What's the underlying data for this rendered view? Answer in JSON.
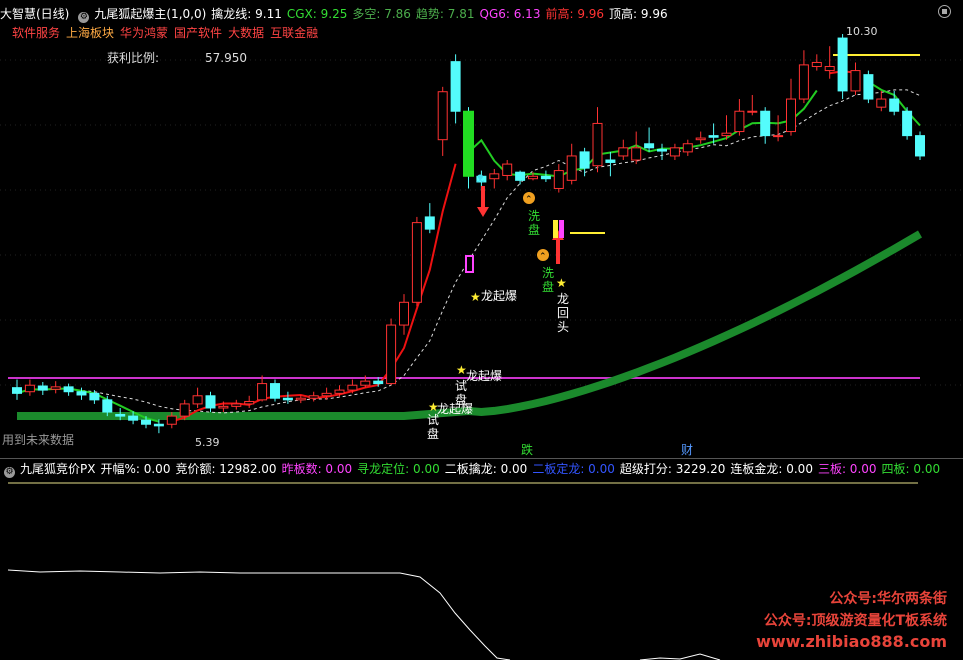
{
  "header": {
    "app_title": "大智慧(日线)",
    "indicator_name": "九尾狐起爆主(1,0,0)",
    "values": [
      {
        "label": "擒龙线: 9.11",
        "color": "#ffffff"
      },
      {
        "label": "CGX: 9.25",
        "color": "#33dd33"
      },
      {
        "label": "多空: 7.86",
        "color": "#4cae4c"
      },
      {
        "label": "趋势: 7.81",
        "color": "#4cae4c"
      },
      {
        "label": "QG6: 6.13",
        "color": "#ff44ff"
      },
      {
        "label": "前高: 9.96",
        "color": "#ff3333"
      },
      {
        "label": "顶高: 9.96",
        "color": "#ffffff"
      }
    ]
  },
  "sectors": [
    {
      "label": "软件服务",
      "color": "#ff4444"
    },
    {
      "label": "上海板块",
      "color": "#ffaa44"
    },
    {
      "label": "华为鸿蒙",
      "color": "#ff4444"
    },
    {
      "label": "国产软件",
      "color": "#ff4444"
    },
    {
      "label": "大数据",
      "color": "#ff4444"
    },
    {
      "label": "互联金融",
      "color": "#ff4444"
    }
  ],
  "main": {
    "profit_label": "获利比例:",
    "profit_value": "57.950",
    "future_data_note": "用到未来数据",
    "high_label": "10.30",
    "low_label": "5.39",
    "signals": {
      "longqibao": "龙起爆",
      "shipan": [
        "试",
        "盘"
      ],
      "xipan": [
        "洗",
        "盘"
      ],
      "longhuitou": [
        "龙",
        "回",
        "头"
      ],
      "die": "跌",
      "cai": "财"
    },
    "colors": {
      "up": "#ff3232",
      "down": "#54fcfc",
      "ma_red": "#ee1111",
      "ma_green": "#22cc22",
      "thick_green": "#1b8a2c",
      "purple": "#cc33cc",
      "yellow": "#ffee33"
    },
    "candles": [
      {
        "o": 5.95,
        "c": 5.88,
        "h": 6.05,
        "l": 5.8
      },
      {
        "o": 5.9,
        "c": 5.98,
        "h": 6.05,
        "l": 5.85
      },
      {
        "o": 5.97,
        "c": 5.92,
        "h": 6.02,
        "l": 5.86
      },
      {
        "o": 5.93,
        "c": 5.96,
        "h": 6.03,
        "l": 5.88
      },
      {
        "o": 5.96,
        "c": 5.9,
        "h": 6.0,
        "l": 5.85
      },
      {
        "o": 5.9,
        "c": 5.86,
        "h": 5.95,
        "l": 5.8
      },
      {
        "o": 5.88,
        "c": 5.8,
        "h": 5.92,
        "l": 5.75
      },
      {
        "o": 5.8,
        "c": 5.65,
        "h": 5.85,
        "l": 5.6
      },
      {
        "o": 5.62,
        "c": 5.6,
        "h": 5.7,
        "l": 5.55
      },
      {
        "o": 5.6,
        "c": 5.55,
        "h": 5.66,
        "l": 5.5
      },
      {
        "o": 5.55,
        "c": 5.5,
        "h": 5.6,
        "l": 5.45
      },
      {
        "o": 5.5,
        "c": 5.48,
        "h": 5.56,
        "l": 5.39
      },
      {
        "o": 5.5,
        "c": 5.6,
        "h": 5.65,
        "l": 5.45
      },
      {
        "o": 5.6,
        "c": 5.75,
        "h": 5.8,
        "l": 5.55
      },
      {
        "o": 5.75,
        "c": 5.85,
        "h": 5.95,
        "l": 5.7
      },
      {
        "o": 5.85,
        "c": 5.7,
        "h": 5.9,
        "l": 5.65
      },
      {
        "o": 5.7,
        "c": 5.72,
        "h": 5.78,
        "l": 5.65
      },
      {
        "o": 5.72,
        "c": 5.75,
        "h": 5.8,
        "l": 5.68
      },
      {
        "o": 5.75,
        "c": 5.78,
        "h": 5.85,
        "l": 5.7
      },
      {
        "o": 5.8,
        "c": 6.0,
        "h": 6.1,
        "l": 5.78
      },
      {
        "o": 6.0,
        "c": 5.82,
        "h": 6.05,
        "l": 5.78
      },
      {
        "o": 5.82,
        "c": 5.8,
        "h": 5.9,
        "l": 5.75
      },
      {
        "o": 5.8,
        "c": 5.82,
        "h": 5.86,
        "l": 5.76
      },
      {
        "o": 5.82,
        "c": 5.85,
        "h": 5.9,
        "l": 5.78
      },
      {
        "o": 5.85,
        "c": 5.88,
        "h": 5.95,
        "l": 5.8
      },
      {
        "o": 5.88,
        "c": 5.92,
        "h": 5.98,
        "l": 5.84
      },
      {
        "o": 5.92,
        "c": 5.98,
        "h": 6.05,
        "l": 5.88
      },
      {
        "o": 5.98,
        "c": 6.03,
        "h": 6.1,
        "l": 5.95
      },
      {
        "o": 6.03,
        "c": 6.0,
        "h": 6.08,
        "l": 5.96
      },
      {
        "o": 6.0,
        "c": 6.72,
        "h": 6.8,
        "l": 5.98
      },
      {
        "o": 6.72,
        "c": 7.0,
        "h": 7.1,
        "l": 6.6
      },
      {
        "o": 7.0,
        "c": 7.98,
        "h": 8.05,
        "l": 6.95
      },
      {
        "o": 8.05,
        "c": 7.9,
        "h": 8.22,
        "l": 7.85
      },
      {
        "o": 9.0,
        "c": 9.59,
        "h": 9.65,
        "l": 8.8
      },
      {
        "o": 9.96,
        "c": 9.35,
        "h": 10.05,
        "l": 9.2
      },
      {
        "o": 9.35,
        "c": 8.55,
        "h": 9.4,
        "l": 8.4
      },
      {
        "o": 8.55,
        "c": 8.48,
        "h": 8.62,
        "l": 8.38
      },
      {
        "o": 8.52,
        "c": 8.58,
        "h": 8.64,
        "l": 8.4
      },
      {
        "o": 8.56,
        "c": 8.7,
        "h": 8.75,
        "l": 8.5
      },
      {
        "o": 8.6,
        "c": 8.5,
        "h": 8.62,
        "l": 8.45
      },
      {
        "o": 8.52,
        "c": 8.55,
        "h": 8.6,
        "l": 8.5
      },
      {
        "o": 8.55,
        "c": 8.52,
        "h": 8.62,
        "l": 8.48
      },
      {
        "o": 8.4,
        "c": 8.62,
        "h": 8.7,
        "l": 8.35
      },
      {
        "o": 8.5,
        "c": 8.8,
        "h": 8.95,
        "l": 8.45
      },
      {
        "o": 8.85,
        "c": 8.65,
        "h": 8.9,
        "l": 8.55
      },
      {
        "o": 8.68,
        "c": 9.2,
        "h": 9.4,
        "l": 8.6
      },
      {
        "o": 8.75,
        "c": 8.72,
        "h": 8.85,
        "l": 8.55
      },
      {
        "o": 8.8,
        "c": 8.9,
        "h": 9.0,
        "l": 8.75
      },
      {
        "o": 8.75,
        "c": 8.9,
        "h": 9.1,
        "l": 8.7
      },
      {
        "o": 8.95,
        "c": 8.9,
        "h": 9.15,
        "l": 8.85
      },
      {
        "o": 8.88,
        "c": 8.86,
        "h": 8.95,
        "l": 8.75
      },
      {
        "o": 8.8,
        "c": 8.9,
        "h": 8.95,
        "l": 8.75
      },
      {
        "o": 8.85,
        "c": 8.95,
        "h": 9.0,
        "l": 8.8
      },
      {
        "o": 9.0,
        "c": 9.02,
        "h": 9.1,
        "l": 8.95
      },
      {
        "o": 9.05,
        "c": 9.03,
        "h": 9.2,
        "l": 8.95
      },
      {
        "o": 9.05,
        "c": 9.08,
        "h": 9.3,
        "l": 9.0
      },
      {
        "o": 9.1,
        "c": 9.35,
        "h": 9.5,
        "l": 9.05
      },
      {
        "o": 9.35,
        "c": 9.35,
        "h": 9.55,
        "l": 9.3
      },
      {
        "o": 9.35,
        "c": 9.05,
        "h": 9.4,
        "l": 8.95
      },
      {
        "o": 9.05,
        "c": 9.05,
        "h": 9.3,
        "l": 8.98
      },
      {
        "o": 9.1,
        "c": 9.5,
        "h": 9.75,
        "l": 9.05
      },
      {
        "o": 9.5,
        "c": 9.92,
        "h": 10.1,
        "l": 9.45
      },
      {
        "o": 9.9,
        "c": 9.95,
        "h": 10.05,
        "l": 9.85
      },
      {
        "o": 9.85,
        "c": 9.9,
        "h": 10.15,
        "l": 9.75
      },
      {
        "o": 10.25,
        "c": 9.6,
        "h": 10.3,
        "l": 9.5
      },
      {
        "o": 9.6,
        "c": 9.85,
        "h": 9.95,
        "l": 9.55
      },
      {
        "o": 9.8,
        "c": 9.5,
        "h": 9.85,
        "l": 9.45
      },
      {
        "o": 9.4,
        "c": 9.5,
        "h": 9.6,
        "l": 9.35
      },
      {
        "o": 9.5,
        "c": 9.35,
        "h": 9.6,
        "l": 9.3
      },
      {
        "o": 9.35,
        "c": 9.05,
        "h": 9.4,
        "l": 9.0
      },
      {
        "o": 9.05,
        "c": 8.8,
        "h": 9.1,
        "l": 8.75
      }
    ]
  },
  "lower": {
    "title": "九尾狐竞价PX",
    "values": [
      {
        "label": "开幅%: 0.00",
        "color": "#ffffff"
      },
      {
        "label": "竞价额: 12982.00",
        "color": "#ffffff"
      },
      {
        "label": "昨板数: 0.00",
        "color": "#ff44ff"
      },
      {
        "label": "寻龙定位: 0.00",
        "color": "#33dd33"
      },
      {
        "label": "二板擒龙: 0.00",
        "color": "#ffffff"
      },
      {
        "label": "二板定龙: 0.00",
        "color": "#3355ff"
      },
      {
        "label": "超级打分: 3229.20",
        "color": "#ffffff"
      },
      {
        "label": "连板金龙: 0.00",
        "color": "#ffffff"
      },
      {
        "label": "三板: 0.00",
        "color": "#ff44ff"
      },
      {
        "label": "四板: 0.00",
        "color": "#33dd33"
      }
    ]
  },
  "watermark": {
    "line1": "公众号:华尔两条街",
    "line2": "公众号:顶级游资量化T板系统",
    "line3": "www.zhibiao888.com"
  }
}
